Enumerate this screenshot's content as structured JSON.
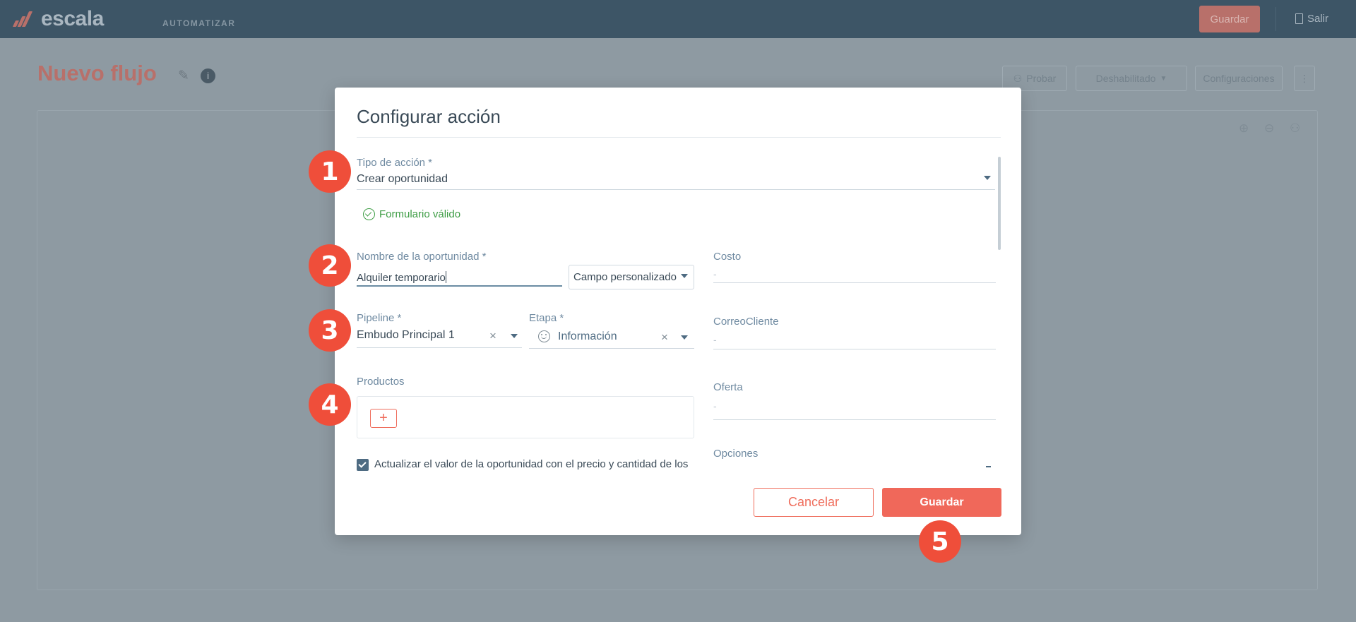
{
  "app": {
    "logo_text": "escala",
    "top_tab": "AUTOMATIZAR",
    "top_save_label": "Guardar",
    "exit_label": "Salir",
    "flow_title": "Nuevo flujo",
    "buttons": {
      "test": "Probar",
      "status": "Deshabilitado",
      "settings": "Configuraciones"
    }
  },
  "modal": {
    "title": "Configurar acción",
    "action_type": {
      "label": "Tipo de acción *",
      "value": "Crear oportunidad"
    },
    "valid_message": "Formulario válido",
    "opportunity_name": {
      "label": "Nombre de la oportunidad *",
      "value": "Alquiler temporario"
    },
    "custom_field_select": "Campo personalizado",
    "pipeline": {
      "label": "Pipeline *",
      "value": "Embudo Principal 1"
    },
    "stage": {
      "label": "Etapa *",
      "value": "Información"
    },
    "products": {
      "label": "Productos",
      "add_symbol": "+"
    },
    "update_checkbox": {
      "label": "Actualizar el valor de la oportunidad con el precio y cantidad de los",
      "checked": true
    },
    "right_fields": [
      {
        "label": "Costo",
        "value": "-"
      },
      {
        "label": "CorreoCliente",
        "value": "-"
      },
      {
        "label": "Oferta",
        "value": "-"
      },
      {
        "label": "Opciones",
        "value": ""
      }
    ],
    "cancel_label": "Cancelar",
    "save_label": "Guardar"
  },
  "steps": [
    "1",
    "2",
    "3",
    "4",
    "5"
  ],
  "icons": {
    "edit": "pencil-icon",
    "info": "info-icon",
    "exit": "door-icon",
    "user": "user-icon",
    "zoom_in": "zoom-in-icon",
    "zoom_out": "zoom-out-icon"
  },
  "colors": {
    "topbar": "#3d5566",
    "accent": "#f0685a",
    "step_marker": "#ef4e3a",
    "valid": "#3e9d45",
    "overlay": "#8e9aa2"
  }
}
